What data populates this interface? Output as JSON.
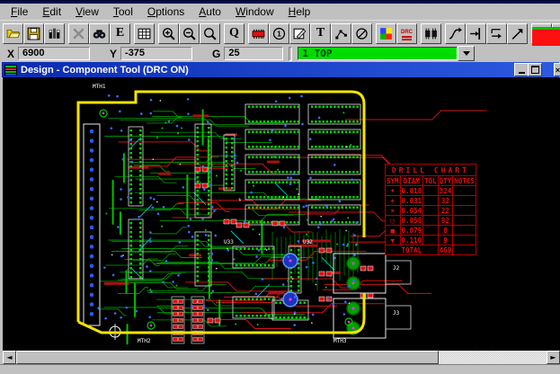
{
  "menubar": {
    "items": [
      "File",
      "Edit",
      "View",
      "Tool",
      "Options",
      "Auto",
      "Window",
      "Help"
    ]
  },
  "toolbar": {
    "buttons": [
      {
        "name": "open",
        "disabled": false
      },
      {
        "name": "save",
        "disabled": false
      },
      {
        "name": "library",
        "disabled": false
      },
      {
        "name": "delete",
        "disabled": true
      },
      {
        "name": "find",
        "disabled": false
      },
      {
        "name": "eco",
        "disabled": false
      },
      {
        "name": "grid",
        "disabled": false
      },
      {
        "name": "zoom-in",
        "disabled": false
      },
      {
        "name": "zoom-out",
        "disabled": false
      },
      {
        "name": "zoom-window",
        "disabled": false
      },
      {
        "name": "query",
        "disabled": false
      },
      {
        "name": "component",
        "disabled": false
      },
      {
        "name": "balloon",
        "disabled": false
      },
      {
        "name": "drafting",
        "disabled": false
      },
      {
        "name": "text",
        "disabled": false
      },
      {
        "name": "dimension",
        "disabled": false
      },
      {
        "name": "keepout",
        "disabled": false
      },
      {
        "name": "colors",
        "disabled": false
      },
      {
        "name": "drc",
        "disabled": false
      },
      {
        "name": "connector",
        "disabled": false
      },
      {
        "name": "route",
        "disabled": false
      },
      {
        "name": "stretch",
        "disabled": false
      },
      {
        "name": "push",
        "disabled": false
      },
      {
        "name": "miter",
        "disabled": false
      },
      {
        "name": "errors",
        "disabled": false
      },
      {
        "name": "drc-check",
        "disabled": false
      }
    ],
    "layer_color": "#ff1010"
  },
  "coordbar": {
    "fields": [
      {
        "label": "X",
        "value": "6900"
      },
      {
        "label": "Y",
        "value": "-375"
      },
      {
        "label": "G",
        "value": "25"
      }
    ],
    "layer_combo": {
      "value": "1  TOP",
      "bg": "#00dc00"
    }
  },
  "child_window": {
    "title": "Design - Component Tool (DRC ON)"
  },
  "drill_chart": {
    "title": "DRILL CHART",
    "columns": [
      "SYM",
      "DIAM",
      "TOL",
      "QTY",
      "NOTES"
    ],
    "rows": [
      {
        "sym": "•",
        "diam": "0.018",
        "tol": "",
        "qty": "324"
      },
      {
        "sym": "+",
        "diam": "0.031",
        "tol": "",
        "qty": "32"
      },
      {
        "sym": "×",
        "diam": "0.054",
        "tol": "",
        "qty": "22"
      },
      {
        "sym": "□",
        "diam": "0.058",
        "tol": "",
        "qty": "82"
      },
      {
        "sym": "■",
        "diam": "0.079",
        "tol": "",
        "qty": "8"
      },
      {
        "sym": "▼",
        "diam": "0.110",
        "tol": "",
        "qty": "9"
      }
    ],
    "total_label": "TOTAL",
    "total_qty": "469"
  },
  "board": {
    "labels": [
      "MTH1",
      "MTH2",
      "MTH3",
      "U32",
      "U33",
      "J2",
      "J3"
    ]
  },
  "scrollbar": {
    "left_arrow": "◄",
    "right_arrow": "►"
  }
}
